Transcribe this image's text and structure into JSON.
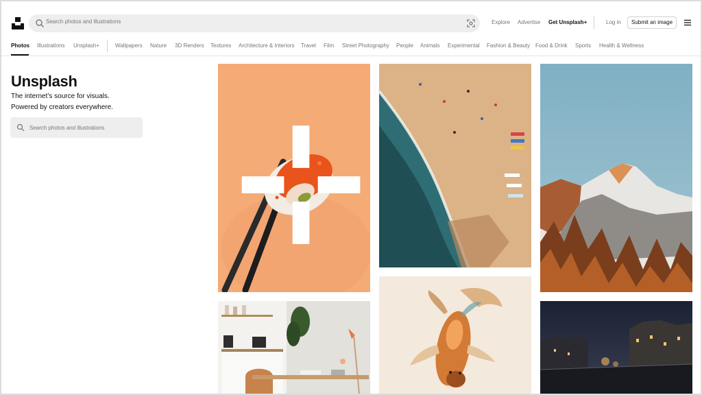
{
  "header": {
    "search_placeholder": "Search photos and illustrations",
    "explore": "Explore",
    "advertise": "Advertise",
    "get_plus": "Get Unsplash+",
    "login": "Log in",
    "submit": "Submit an image"
  },
  "categories": [
    "Photos",
    "Illustrations",
    "Unsplash+",
    "Wallpapers",
    "Nature",
    "3D Renders",
    "Textures",
    "Architecture & Interiors",
    "Travel",
    "Film",
    "Street Photography",
    "People",
    "Animals",
    "Experimental",
    "Fashion & Beauty",
    "Food & Drink",
    "Sports",
    "Health & Wellness"
  ],
  "active_category": "Photos",
  "hero": {
    "title": "Unsplash",
    "line1": "The internet’s source for visuals.",
    "line2": "Powered by creators everywhere.",
    "search_placeholder": "Search photos and illustrations"
  },
  "photos": [
    {
      "subject": "sushi-with-chopsticks",
      "premium": true
    },
    {
      "subject": "aerial-beach",
      "premium": false
    },
    {
      "subject": "snowy-mountain",
      "premium": false
    },
    {
      "subject": "home-office-interior",
      "premium": false
    },
    {
      "subject": "koi-fish",
      "premium": false
    },
    {
      "subject": "night-city-bridge",
      "premium": false
    }
  ],
  "colors": {
    "accent": "#111111",
    "muted_text": "#767676",
    "search_bg": "#eeeeee"
  }
}
